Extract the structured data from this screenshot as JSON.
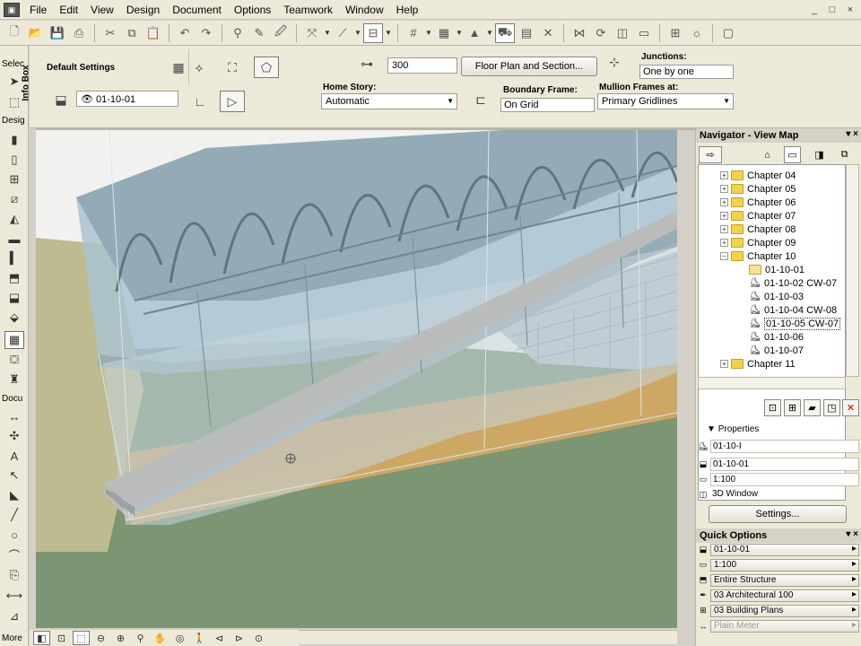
{
  "menubar": {
    "items": [
      "File",
      "Edit",
      "View",
      "Design",
      "Document",
      "Options",
      "Teamwork",
      "Window",
      "Help"
    ],
    "window_controls": [
      "_",
      "□",
      "×"
    ]
  },
  "toolbox": {
    "label_select": "Selec",
    "label_design": "Desig",
    "label_document": "Docu",
    "label_more": "More"
  },
  "infobox": {
    "tab_label": "Info Box",
    "default_settings": "Default Settings",
    "layer_value": "01-10-01",
    "spacing_value": "300",
    "floor_plan_button": "Floor Plan and Section...",
    "junctions_label": "Junctions:",
    "junctions_value": "One by one",
    "home_story_label": "Home Story:",
    "home_story_value": "Automatic",
    "boundary_frame_label": "Boundary Frame:",
    "boundary_frame_value": "On Grid",
    "mullion_frames_label": "Mullion Frames at:",
    "mullion_frames_value": "Primary Gridlines"
  },
  "navigator": {
    "title": "Navigator - View Map",
    "tree": [
      {
        "label": "Chapter 04",
        "kind": "folder",
        "expanded": false
      },
      {
        "label": "Chapter 05",
        "kind": "folder",
        "expanded": false
      },
      {
        "label": "Chapter 06",
        "kind": "folder",
        "expanded": false
      },
      {
        "label": "Chapter 07",
        "kind": "folder",
        "expanded": false
      },
      {
        "label": "Chapter 08",
        "kind": "folder",
        "expanded": false
      },
      {
        "label": "Chapter 09",
        "kind": "folder",
        "expanded": false
      },
      {
        "label": "Chapter 10",
        "kind": "folder",
        "expanded": true
      },
      {
        "label": "01-10-01",
        "kind": "subfolder"
      },
      {
        "label": "01-10-02 CW-07",
        "kind": "view"
      },
      {
        "label": "01-10-03",
        "kind": "view"
      },
      {
        "label": "01-10-04 CW-08",
        "kind": "view"
      },
      {
        "label": "01-10-05 CW-07",
        "kind": "view",
        "selected": true
      },
      {
        "label": "01-10-06",
        "kind": "view"
      },
      {
        "label": "01-10-07",
        "kind": "view"
      },
      {
        "label": "Chapter 11",
        "kind": "folder",
        "expanded": false
      }
    ],
    "properties_label": "Properties",
    "properties": {
      "id": "01-10-I",
      "name": "01-10-01",
      "scale": "1:100",
      "source": "3D Window"
    },
    "settings_button": "Settings..."
  },
  "quick_options": {
    "title": "Quick Options",
    "items": [
      {
        "icon": "layer-icon",
        "value": "01-10-01"
      },
      {
        "icon": "scale-icon",
        "value": "1:100"
      },
      {
        "icon": "structure-icon",
        "value": "Entire Structure"
      },
      {
        "icon": "pen-icon",
        "value": "03 Architectural 100"
      },
      {
        "icon": "model-icon",
        "value": "03 Building Plans"
      },
      {
        "icon": "dimension-icon",
        "value": "Plain Meter",
        "disabled": true
      }
    ]
  }
}
